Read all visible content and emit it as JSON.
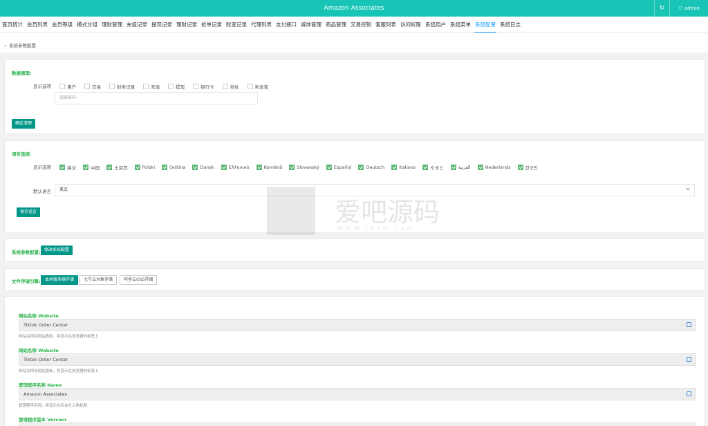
{
  "header": {
    "title": "Amazon Associates",
    "refresh_icon": "↻",
    "user": "admin"
  },
  "nav": [
    {
      "label": "首页统计"
    },
    {
      "label": "会员列表"
    },
    {
      "label": "会员等级"
    },
    {
      "label": "模式分组"
    },
    {
      "label": "理财管理"
    },
    {
      "label": "充值记录"
    },
    {
      "label": "提现记录"
    },
    {
      "label": "理财记录"
    },
    {
      "label": "抢单记录"
    },
    {
      "label": "账变记录"
    },
    {
      "label": "代理列表"
    },
    {
      "label": "支付接口"
    },
    {
      "label": "媒体管理"
    },
    {
      "label": "商品管理"
    },
    {
      "label": "交易控制"
    },
    {
      "label": "客服列表"
    },
    {
      "label": "访问权限"
    },
    {
      "label": "系统用户"
    },
    {
      "label": "系统菜单"
    },
    {
      "label": "系统配置",
      "active": true
    },
    {
      "label": "系统日志"
    }
  ],
  "breadcrumb": {
    "sep": "»",
    "label": "系统参数配置"
  },
  "data_clean": {
    "title": "数据清理:",
    "row_label": "显示选项",
    "options": [
      "用户",
      "交易",
      "财务记录",
      "充值",
      "提现",
      "银行卡",
      "地址",
      "利息宝"
    ],
    "password_placeholder": "请输密码",
    "button": "确定清理"
  },
  "language": {
    "title": "语言选择:",
    "row_label": "显示选项",
    "options": [
      "英文",
      "中国",
      "土耳其",
      "Polski",
      "čeština",
      "Dansk",
      "Ελληνικά",
      "Română",
      "Slovenský",
      "Español",
      "Deutsch",
      "Italiano",
      "やまと",
      "العربية",
      "Nederlands",
      "한국인"
    ],
    "default_label": "默认语言",
    "default_value": "英文",
    "button": "保存语言"
  },
  "sys_params": {
    "title": "系统参数配置:",
    "button": "修改系统配置"
  },
  "storage": {
    "title": "文件存储引擎:",
    "options": [
      {
        "label": "本地服务器存储",
        "active": true
      },
      {
        "label": "七牛云对象存储",
        "active": false
      },
      {
        "label": "阿里云OSS存储",
        "active": false
      }
    ]
  },
  "fields": [
    {
      "label": "网站名称 Website",
      "value": "Tiktok  Order Center",
      "help": "网站名称及网站图标，将显示在浏览器的标签上"
    },
    {
      "label": "网站名称 Website",
      "value": "Tiktok  Order Center",
      "help": "网站名称及网站图标，将显示在浏览器的标签上"
    },
    {
      "label": "管理程序名称 Name",
      "value": "Amazon Associates",
      "help": "管理程序名称，将显示在后台左上角标题"
    },
    {
      "label": "管理程序版本 Version",
      "value": "",
      "help": ""
    }
  ],
  "watermark": {
    "main": "爱吧源码",
    "sub": "WWW.I8YM.com"
  },
  "colors": {
    "header": "#17c4b6",
    "accent_green": "#2bb24c",
    "button_teal": "#009688",
    "nav_active": "#1E9FFF"
  }
}
